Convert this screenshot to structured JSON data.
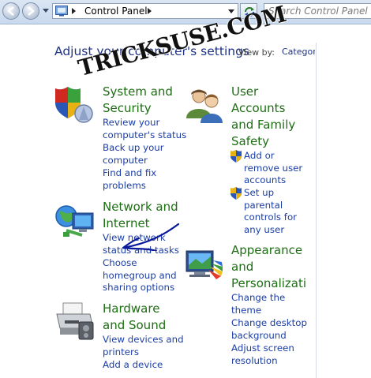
{
  "address_bar": {
    "path": "Control Panel",
    "search_placeholder": "Search Control Panel"
  },
  "header": {
    "title": "Adjust your computer's settings",
    "view_by_label": "View by:",
    "view_by_value": "Category"
  },
  "watermark": "TRICKSUSE.COM",
  "categories": {
    "system": {
      "title": [
        "System and",
        "Security"
      ],
      "links": [
        [
          "Review your",
          "computer's status"
        ],
        [
          "Back up your",
          "computer"
        ],
        [
          "Find and fix",
          "problems"
        ]
      ]
    },
    "network": {
      "title": [
        "Network and",
        "Internet"
      ],
      "links": [
        [
          "View network",
          "status and tasks"
        ],
        [
          "Choose",
          "homegroup and",
          "sharing options"
        ]
      ]
    },
    "hardware": {
      "title": [
        "Hardware",
        "and Sound"
      ],
      "links": [
        [
          "View devices and",
          "printers"
        ],
        [
          "Add a device"
        ]
      ]
    },
    "users": {
      "title": [
        "User",
        "Accounts",
        "and Family",
        "Safety"
      ],
      "links": [
        [
          "Add or",
          "remove user",
          "accounts"
        ],
        [
          "Set up",
          "parental",
          "controls for",
          "any user"
        ]
      ]
    },
    "appearance": {
      "title": [
        "Appearance",
        "and",
        "Personalizati"
      ],
      "links": [
        [
          "Change the",
          "theme"
        ],
        [
          "Change desktop",
          "background"
        ],
        [
          "Adjust screen",
          "resolution"
        ]
      ]
    }
  },
  "colors": {
    "heading": "#1e3287",
    "category_title": "#1e6e14",
    "link": "#1b3ea6"
  }
}
